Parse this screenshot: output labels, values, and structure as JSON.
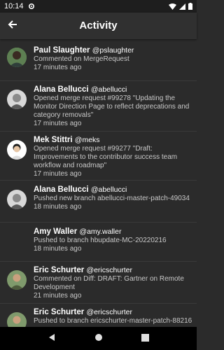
{
  "status_bar": {
    "time": "10:14"
  },
  "app_bar": {
    "title": "Activity"
  },
  "activities": [
    {
      "name": "Paul Slaughter",
      "handle": "@pslaughter",
      "description": "Commented on MergeRequest",
      "time": "17 minutes ago"
    },
    {
      "name": "Alana Bellucci",
      "handle": "@abellucci",
      "description": "Opened merge request #99278 \"Updating the Monitor Direction Page to reflect deprecations and category removals\"",
      "time": "17 minutes ago"
    },
    {
      "name": "Mek Stittri",
      "handle": "@meks",
      "description": "Opened merge request #99277 \"Draft: Improvements to the contributor success team workflow and roadmap\"",
      "time": "17 minutes ago"
    },
    {
      "name": "Alana Bellucci",
      "handle": "@abellucci",
      "description": "Pushed new branch abellucci-master-patch-49034",
      "time": "18 minutes ago"
    },
    {
      "name": "Amy Waller",
      "handle": "@amy.waller",
      "description": "Pushed to branch hbupdate-MC-20220216",
      "time": "18 minutes ago"
    },
    {
      "name": "Eric Schurter",
      "handle": "@ericschurter",
      "description": "Commented on Diff: DRAFT: Gartner on Remote Development",
      "time": "21 minutes ago"
    },
    {
      "name": "Eric Schurter",
      "handle": "@ericschurter",
      "description": "Pushed to branch ericschurter-master-patch-88216",
      "time": ""
    }
  ]
}
